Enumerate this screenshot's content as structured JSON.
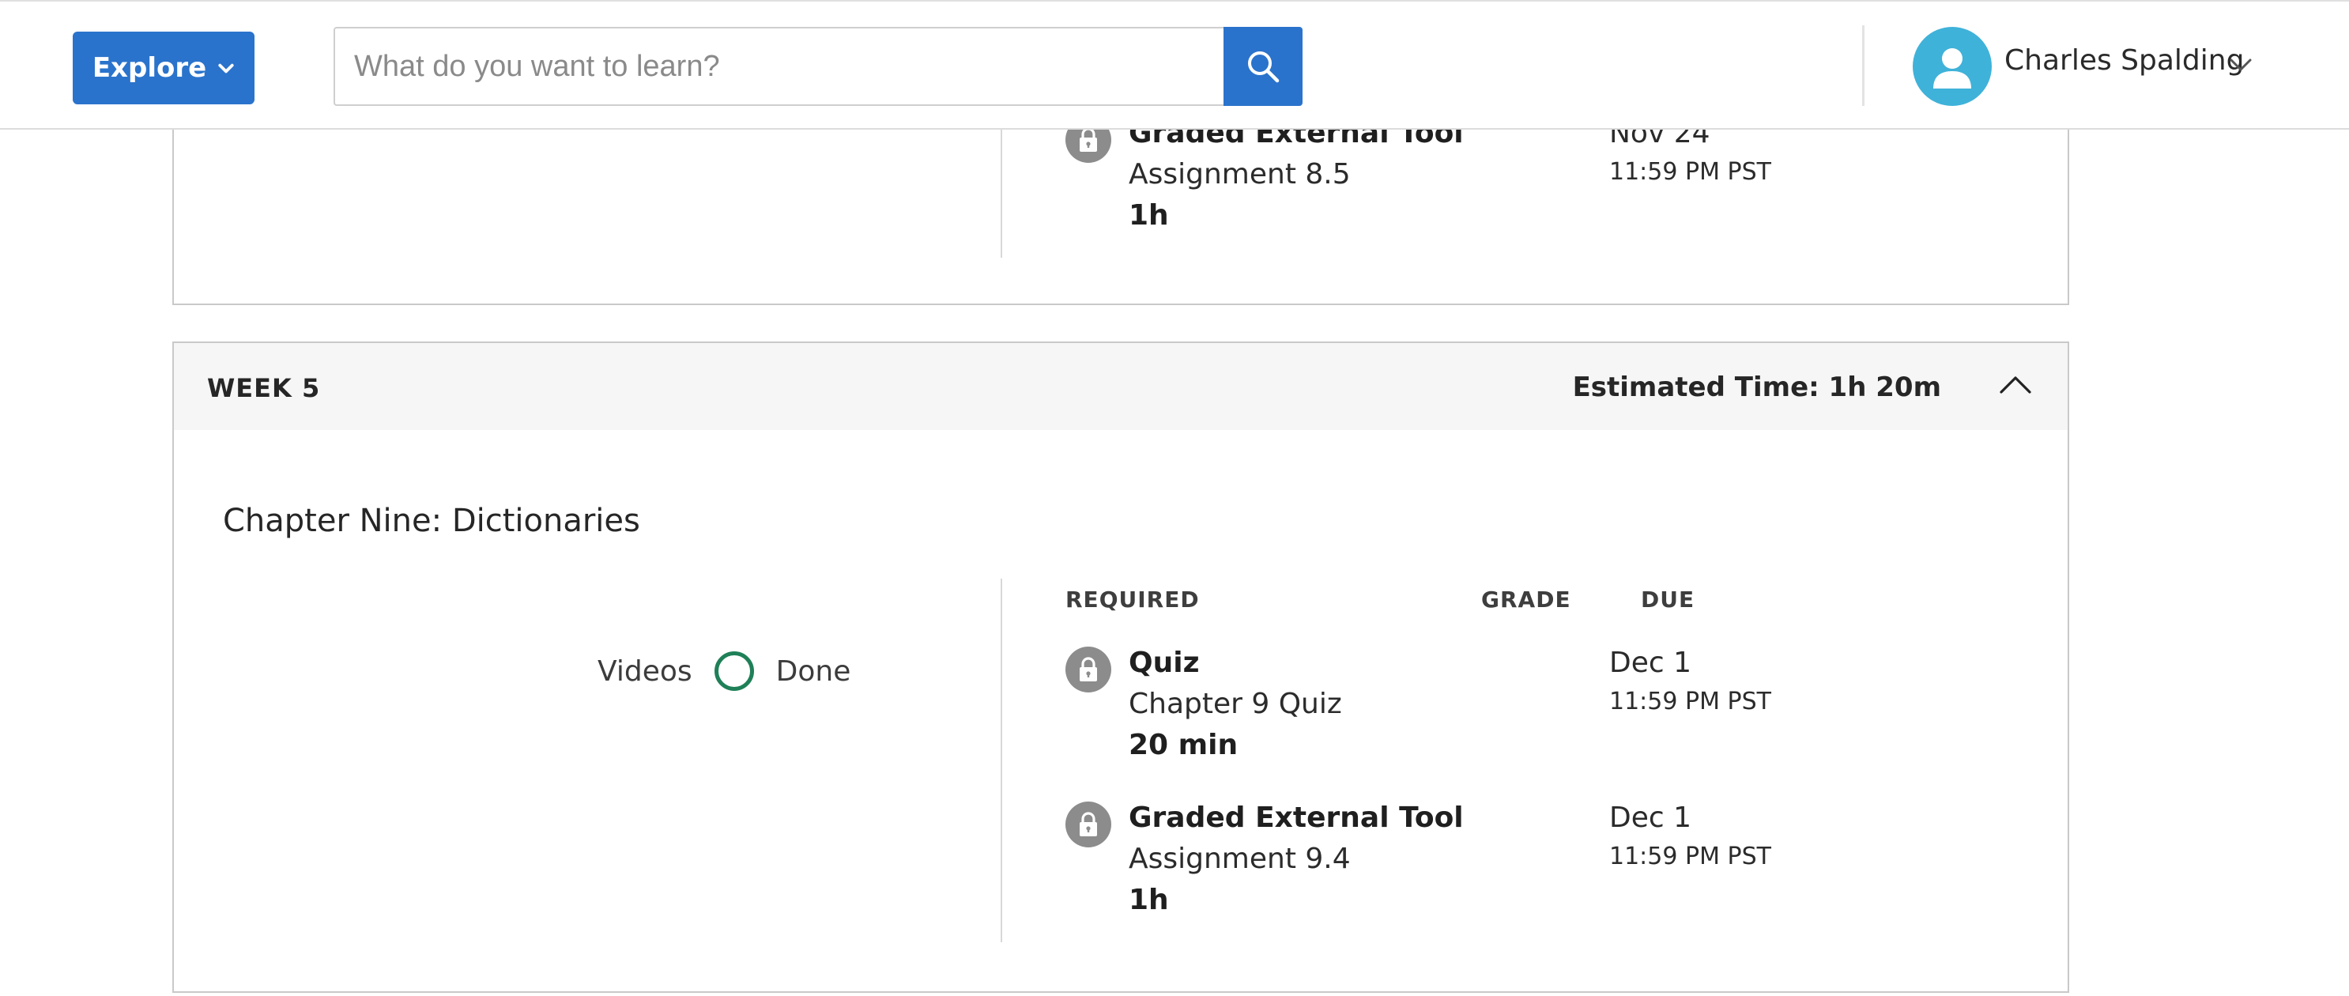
{
  "header": {
    "explore_label": "Explore",
    "search_placeholder": "What do you want to learn?",
    "user_name": "Charles Spalding"
  },
  "previous_week": {
    "item": {
      "type": "Graded External Tool",
      "name": "Assignment 8.5",
      "duration": "1h",
      "due_date": "Nov 24",
      "due_time": "11:59 PM PST"
    }
  },
  "week5": {
    "title": "WEEK 5",
    "estimated_time": "Estimated Time: 1h 20m",
    "chapter_title": "Chapter Nine: Dictionaries",
    "videos_label": "Videos",
    "done_label": "Done",
    "columns": {
      "required": "REQUIRED",
      "grade": "GRADE",
      "due": "DUE"
    },
    "items": [
      {
        "type": "Quiz",
        "name": "Chapter 9 Quiz",
        "duration": "20 min",
        "due_date": "Dec 1",
        "due_time": "11:59 PM PST"
      },
      {
        "type": "Graded External Tool",
        "name": "Assignment 9.4",
        "duration": "1h",
        "due_date": "Dec 1",
        "due_time": "11:59 PM PST"
      }
    ]
  },
  "colors": {
    "primary": "#2a73cc",
    "avatar": "#3fb2d9",
    "done_ring": "#1f8058",
    "lock": "#8c8c8c"
  },
  "icons": {
    "explore_chevron": "chevron-down-icon",
    "search": "search-icon",
    "avatar": "user-icon",
    "user_menu": "chevron-down-icon",
    "collapse": "chevron-up-icon",
    "lock": "lock-icon",
    "done": "circle-outline-icon"
  }
}
